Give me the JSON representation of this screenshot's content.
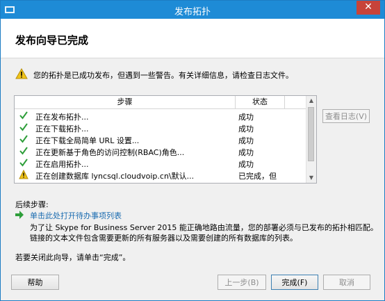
{
  "window": {
    "title": "发布拓扑",
    "close_glyph": "✕"
  },
  "header": {
    "title": "发布向导已完成"
  },
  "warning": {
    "text": "您的拓扑是已成功发布，但遇到一些警告。有关详细信息，请检查日志文件。"
  },
  "list": {
    "columns": {
      "step": "步骤",
      "status": "状态"
    },
    "rows": [
      {
        "step": "正在发布拓扑...",
        "status": "成功",
        "icon": "check-icon"
      },
      {
        "step": "正在下载拓扑...",
        "status": "成功",
        "icon": "check-icon"
      },
      {
        "step": "正在下载全局简单 URL 设置...",
        "status": "成功",
        "icon": "check-icon"
      },
      {
        "step": "正在更新基于角色的访问控制(RBAC)角色...",
        "status": "成功",
        "icon": "check-icon"
      },
      {
        "step": "正在启用拓扑...",
        "status": "成功",
        "icon": "check-icon"
      },
      {
        "step": "正在创建数据库 lyncsql.cloudvoip.cn\\默认...",
        "status": "已完成，但",
        "icon": "warning-icon"
      }
    ]
  },
  "buttons": {
    "view_log": "查看日志(V)",
    "help": "帮助",
    "back": "上一步(B)",
    "finish": "完成(F)",
    "cancel": "取消"
  },
  "next_steps": {
    "label": "后续步骤:",
    "link": "单击此处打开待办事项列表",
    "description_line1": "为了让 Skype for Business Server 2015 能正确地路由流量，您的部署必须与已发布的拓扑相匹配。",
    "description_line2": "链接的文本文件包含需要更新的所有服务器以及需要创建的所有数据库的列表。"
  },
  "close_note": "若要关闭此向导，请单击“完成”。",
  "colors": {
    "titlebar": "#1e8bd6",
    "link": "#1a6bb0",
    "check": "#2e9e3a",
    "warning": "#f0c419"
  }
}
